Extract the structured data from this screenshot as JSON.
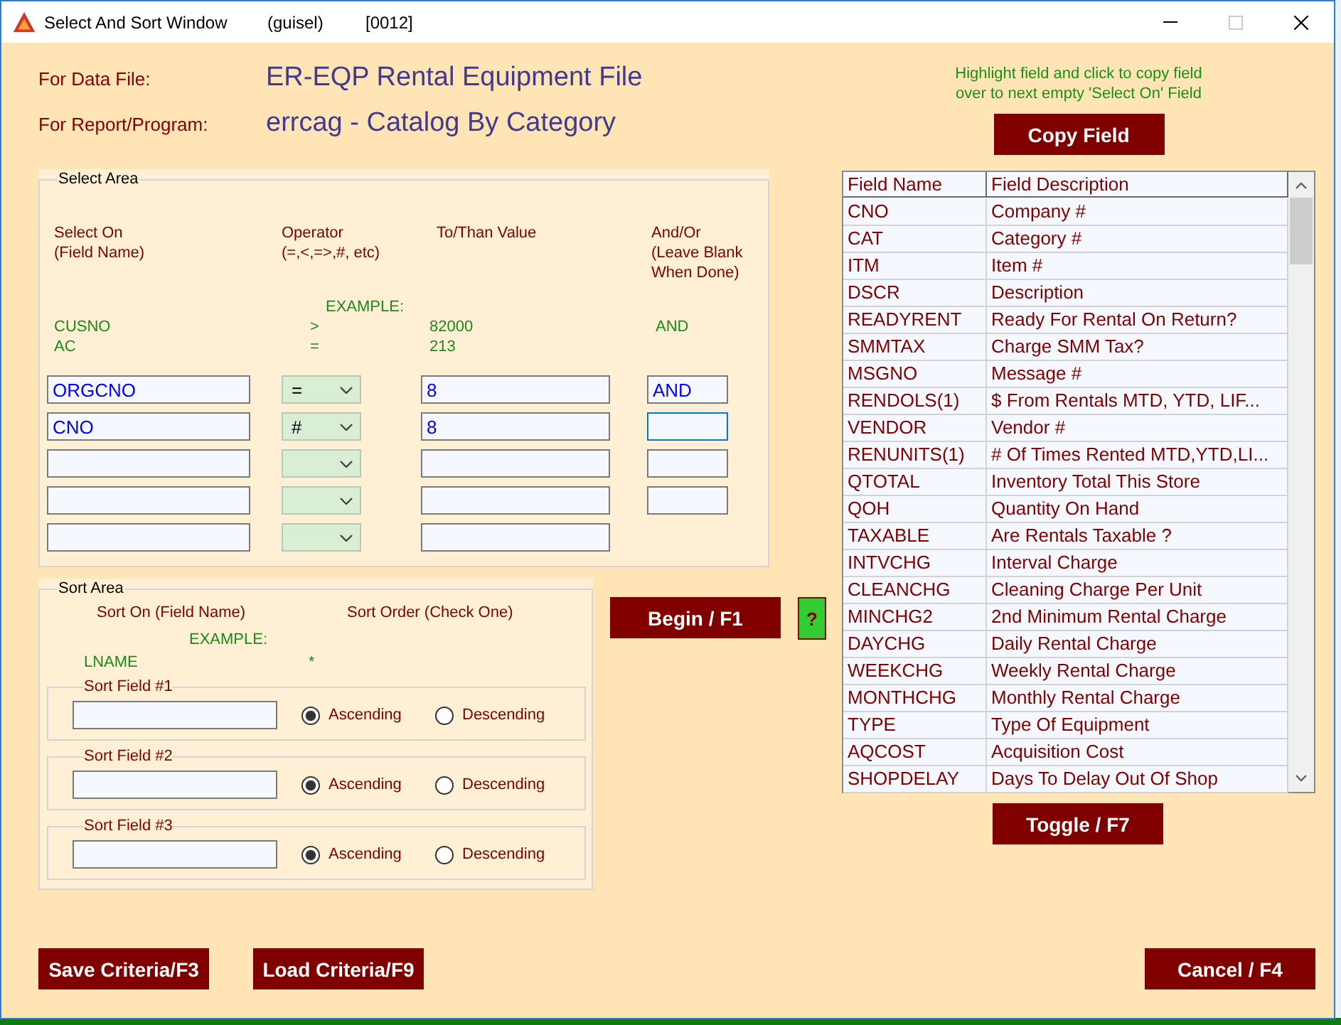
{
  "window": {
    "title": "Select And Sort Window",
    "user": "(guisel)",
    "code": "[0012]",
    "controls": [
      {
        "kind": "minimize",
        "disabled": false
      },
      {
        "kind": "maximize",
        "disabled": true
      },
      {
        "kind": "close",
        "disabled": false
      }
    ]
  },
  "header": {
    "data_file_label": "For Data File:",
    "data_file": "ER-EQP Rental Equipment File",
    "report_label": "For Report/Program:",
    "report": "errcag - Catalog By Category",
    "hint": [
      "Highlight field and click to copy field",
      "over to next empty 'Select On' Field"
    ],
    "copy_button": "Copy Field"
  },
  "select_area": {
    "title": "Select Area",
    "columns": [
      [
        "Select On",
        "(Field Name)"
      ],
      [
        "Operator",
        "(=,<,=>,#, etc)"
      ],
      [
        "To/Than Value"
      ],
      [
        "And/Or",
        "(Leave Blank",
        "When Done)"
      ]
    ],
    "example_label": "EXAMPLE:",
    "examples": [
      {
        "field": "CUSNO",
        "operator": ">",
        "value": "82000",
        "and_or": "AND"
      },
      {
        "field": "AC",
        "operator": "=",
        "value": "213"
      }
    ],
    "rows": [
      {
        "kind": "full",
        "field": "ORGCNO",
        "operator": "=",
        "value": "8",
        "and_or": "AND",
        "and_or_focused": false
      },
      {
        "kind": "full",
        "field": "CNO",
        "operator": "#",
        "value": "8",
        "and_or_focused": true
      },
      {
        "kind": "full",
        "and_or_focused": false
      },
      {
        "kind": "full",
        "and_or_focused": false
      },
      {
        "kind": "last"
      }
    ]
  },
  "sort_area": {
    "title": "Sort Area",
    "columns": [
      "Sort On (Field Name)",
      "Sort Order (Check One)"
    ],
    "example_label": "EXAMPLE:",
    "example": {
      "field": "LNAME",
      "order": "*"
    },
    "fields": [
      {
        "label": "Sort Field #1",
        "options": [
          {
            "label": "Ascending",
            "selected": true
          },
          {
            "label": "Descending",
            "selected": false
          }
        ]
      },
      {
        "label": "Sort Field #2",
        "options": [
          {
            "label": "Ascending",
            "selected": true
          },
          {
            "label": "Descending",
            "selected": false
          }
        ]
      },
      {
        "label": "Sort Field #3",
        "options": [
          {
            "label": "Ascending",
            "selected": true
          },
          {
            "label": "Descending",
            "selected": false
          }
        ]
      }
    ]
  },
  "run": {
    "begin_button": "Begin / F1",
    "help_button": "?"
  },
  "field_table": {
    "columns": [
      "Field Name",
      "Field Description"
    ],
    "rows": [
      {
        "name": "CNO",
        "description": "Company #"
      },
      {
        "name": "CAT",
        "description": "Category #"
      },
      {
        "name": "ITM",
        "description": "Item #"
      },
      {
        "name": "DSCR",
        "description": "Description"
      },
      {
        "name": "READYRENT",
        "description": "Ready For Rental On Return?"
      },
      {
        "name": "SMMTAX",
        "description": "Charge SMM Tax?"
      },
      {
        "name": "MSGNO",
        "description": "Message #"
      },
      {
        "name": "RENDOLS(1)",
        "description": "$ From Rentals MTD, YTD, LIF..."
      },
      {
        "name": "VENDOR",
        "description": "Vendor #"
      },
      {
        "name": "RENUNITS(1)",
        "description": "# Of Times Rented MTD,YTD,LI..."
      },
      {
        "name": "QTOTAL",
        "description": "Inventory Total This Store"
      },
      {
        "name": "QOH",
        "description": "Quantity On Hand"
      },
      {
        "name": "TAXABLE",
        "description": "Are Rentals Taxable ?"
      },
      {
        "name": "INTVCHG",
        "description": "Interval Charge"
      },
      {
        "name": "CLEANCHG",
        "description": "Cleaning Charge Per Unit"
      },
      {
        "name": "MINCHG2",
        "description": "2nd Minimum Rental Charge"
      },
      {
        "name": "DAYCHG",
        "description": "Daily Rental Charge"
      },
      {
        "name": "WEEKCHG",
        "description": "Weekly Rental Charge"
      },
      {
        "name": "MONTHCHG",
        "description": "Monthly Rental Charge"
      },
      {
        "name": "TYPE",
        "description": "Type Of Equipment"
      },
      {
        "name": "AQCOST",
        "description": "Acquisition Cost"
      },
      {
        "name": "SHOPDELAY",
        "description": "Days To Delay Out Of Shop"
      }
    ],
    "toggle_button": "Toggle / F7"
  },
  "footer": {
    "left_buttons": [
      "Save Criteria/F3",
      "Load Criteria/F9"
    ],
    "right_buttons": [
      "Cancel / F4"
    ]
  }
}
